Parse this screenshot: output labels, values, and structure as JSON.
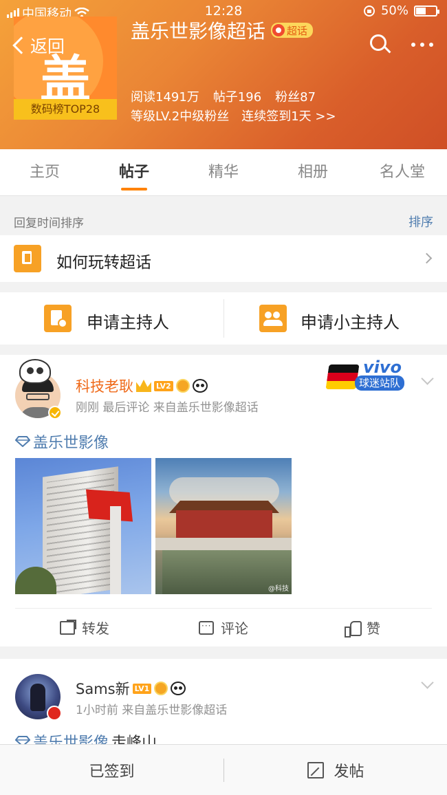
{
  "status_bar": {
    "carrier": "中国移动",
    "time": "12:28",
    "battery": "50%",
    "battery_level": 0.5
  },
  "header": {
    "back_label": "返回",
    "logo_char": "盖",
    "rank_label": "数码榜TOP28",
    "title": "盖乐世影像超话",
    "badge": "超话",
    "stats": {
      "reads": "阅读1491万",
      "posts": "帖子196",
      "fans": "粉丝87"
    },
    "level": "等级LV.2中级粉丝",
    "checkin": "连续签到1天 >>"
  },
  "tabs": [
    {
      "label": "主页",
      "active": false
    },
    {
      "label": "帖子",
      "active": true
    },
    {
      "label": "精华",
      "active": false
    },
    {
      "label": "相册",
      "active": false
    },
    {
      "label": "名人堂",
      "active": false
    }
  ],
  "sort": {
    "label": "回复时间排序",
    "button": "排序"
  },
  "how_to": {
    "label": "如何玩转超话"
  },
  "apply": {
    "host": "申请主持人",
    "sub_host": "申请小主持人"
  },
  "post1": {
    "username": "科技老耿",
    "level_badge": "LV2",
    "medal_char": "誉",
    "meta": "刚刚  最后评论  来自盖乐世影像超话",
    "topic": "盖乐世影像",
    "brand": "vivo",
    "brand_sub": "球迷站队",
    "image_watermark": "@科技",
    "actions": {
      "share": "转发",
      "comment": "评论",
      "like": "赞"
    }
  },
  "post2": {
    "username": "Sams新",
    "level_badge": "LV1",
    "medal_char": "誉",
    "meta": "1小时前  来自盖乐世影像超话",
    "topic": "盖乐世影像",
    "topic_rest": "走峰山"
  },
  "bottom_bar": {
    "checked_in": "已签到",
    "post": "发帖"
  },
  "colors": {
    "accent": "#ff8200",
    "link": "#507daf",
    "header_start": "#f5a23a",
    "header_end": "#cf4f26"
  }
}
